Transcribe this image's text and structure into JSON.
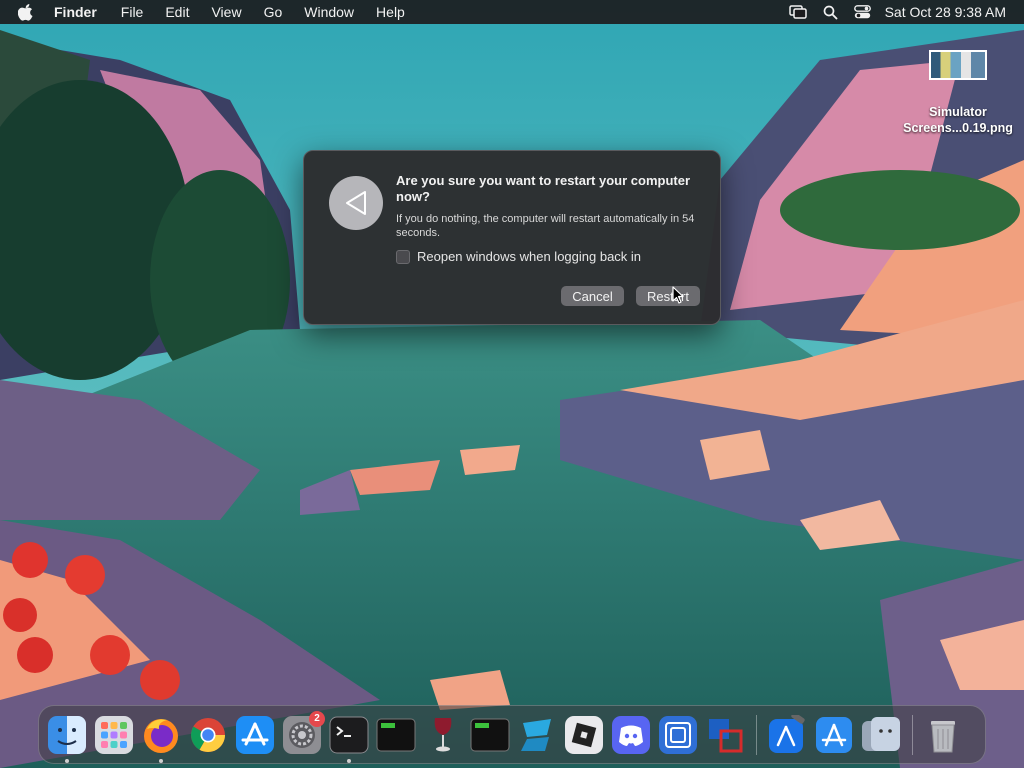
{
  "menubar": {
    "app_name": "Finder",
    "items": [
      "File",
      "Edit",
      "View",
      "Go",
      "Window",
      "Help"
    ],
    "clock": "Sat Oct 28  9:38 AM"
  },
  "desktop": {
    "file_label_line1": "Simulator",
    "file_label_line2": "Screens...0.19.png"
  },
  "dialog": {
    "title": "Are you sure you want to restart your computer now?",
    "message": "If you do nothing, the computer will restart automatically in 54 seconds.",
    "checkbox_label": "Reopen windows when logging back in",
    "checkbox_checked": false,
    "cancel_label": "Cancel",
    "restart_label": "Restart"
  },
  "dock": {
    "settings_badge": "2",
    "items": [
      "finder-icon",
      "launchpad-icon",
      "firefox-icon",
      "chrome-icon",
      "app-store-icon",
      "system-settings-icon",
      "terminal-icon",
      "exec-icon",
      "wine-icon",
      "exec-icon",
      "app-icon",
      "roblox-icon",
      "discord-icon",
      "app-icon",
      "virtualbox-icon",
      "xcode-icon",
      "xcode-icon",
      "finder-icon",
      "trash-icon"
    ]
  },
  "colors": {
    "menubar_bg": "#1c1c1e",
    "dialog_bg": "#2c2c2e",
    "button_bg": "#6b6b6f",
    "badge": "#e5484d"
  }
}
